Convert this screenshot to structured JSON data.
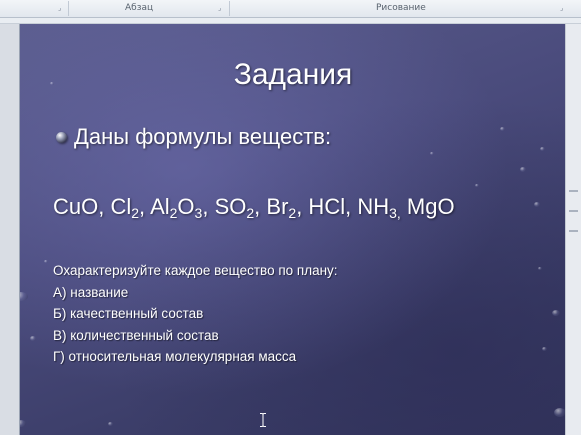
{
  "ribbon": {
    "groups": [
      "Абзац",
      "Рисование"
    ],
    "launcher_glyph": "⌟"
  },
  "slide": {
    "title": "Задания",
    "bullet": "Даны формулы  веществ:",
    "formulas": {
      "cuo": "CuO, ",
      "cl": "Cl",
      "cl_sub": "2",
      "sep1": ",  ",
      "al": "Al",
      "al_sub": "2",
      "o": "O",
      "o_sub": "3",
      "sep2": ", ",
      "so": "SO",
      "so_sub": "2",
      "sep3": ", ",
      "br": "Br",
      "br_sub": "2",
      "sep4": ", HCl, ",
      "nh": "NH",
      "nh_sub": "3,",
      "mgo": " MgO"
    },
    "plan": {
      "intro": "Охарактеризуйте каждое вещество по плану:",
      "items": [
        "А) название",
        "Б) качественный состав",
        "В) количественный состав",
        "Г) относительная молекулярная масса"
      ]
    }
  },
  "colors": {
    "slide_background": "#4a4b7c",
    "slide_text": "#ffffff",
    "ribbon_background": "#e2e7ee"
  }
}
